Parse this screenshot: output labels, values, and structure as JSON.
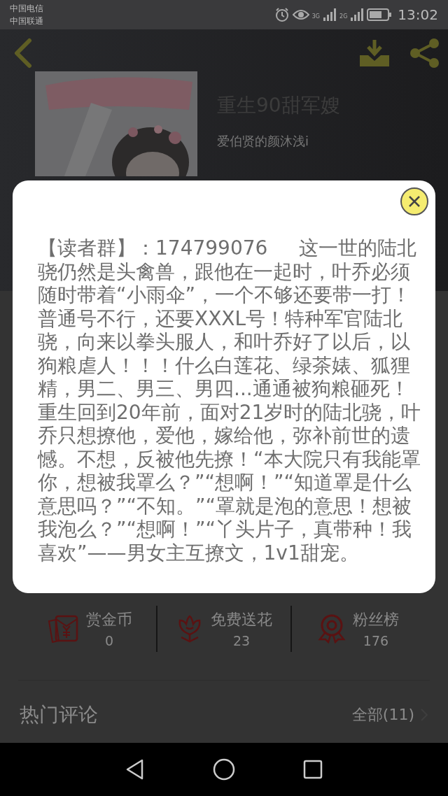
{
  "status_bar": {
    "carriers": [
      "中国电信",
      "中国联通"
    ],
    "networks": [
      "3G",
      "2G"
    ],
    "time": "13:02"
  },
  "book": {
    "title": "重生90甜军嫂",
    "author": "爱伯贤的颜沐浅i"
  },
  "stats": [
    {
      "kind": "coins",
      "label": "赏金币",
      "count": "0"
    },
    {
      "kind": "flower",
      "label": "免费送花",
      "count": "23"
    },
    {
      "kind": "fans",
      "label": "粉丝榜",
      "count": "176"
    }
  ],
  "comments": {
    "title": "热门评论",
    "all_link": "全部(11)"
  },
  "dialog": {
    "text": "【读者群】：174799076     这一世的陆北骁仍然是头禽兽，跟他在一起时，叶乔必须随时带着“小雨伞”，一个不够还要带一打！普通号不行，还要XXXL号！特种军官陆北骁，向来以拳头服人，和叶乔好了以后，以狗粮虐人！！！什么白莲花、绿茶婊、狐狸精，男二、男三、男四...通通被狗粮砸死！重生回到20年前，面对21岁时的陆北骁，叶乔只想撩他，爱他，嫁给他，弥补前世的遗憾。不想，反被他先撩！“本大院只有我能罩你，想被我罩么？”“想啊！”“知道罩是什么意思吗？”“不知。”“罩就是泡的意思！想被我泡么？”“想啊！”“丫头片子，真带种！我喜欢”——男女主互撩文，1v1甜宠。"
  }
}
